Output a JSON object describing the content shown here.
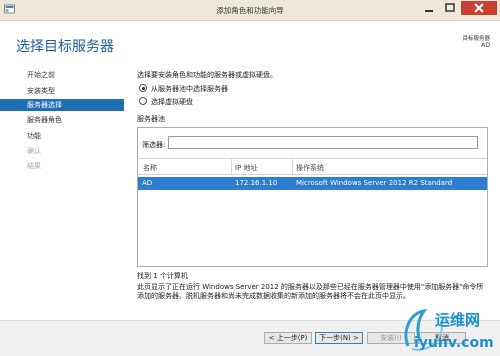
{
  "window": {
    "title": "添加角色和功能向导",
    "colors": {
      "titlebar": "#ede8d9",
      "close_button": "#c84031",
      "accent": "#1f6fb5"
    }
  },
  "header": {
    "page_title": "选择目标服务器",
    "destination_label": "目标服务器",
    "destination_value": "AD"
  },
  "nav": {
    "items": [
      {
        "label": "开始之前",
        "state": "normal"
      },
      {
        "label": "安装类型",
        "state": "normal"
      },
      {
        "label": "服务器选择",
        "state": "active"
      },
      {
        "label": "服务器角色",
        "state": "normal"
      },
      {
        "label": "功能",
        "state": "normal"
      },
      {
        "label": "确认",
        "state": "disabled"
      },
      {
        "label": "结果",
        "state": "disabled"
      }
    ]
  },
  "main": {
    "instruction": "选择要安装角色和功能的服务器或虚拟硬盘。",
    "options": [
      {
        "label": "从服务器池中选择服务器",
        "checked": true
      },
      {
        "label": "选择虚拟硬盘",
        "checked": false
      }
    ],
    "pool_label": "服务器池",
    "filter_label": "筛选器:",
    "filter_value": "",
    "columns": [
      "名称",
      "IP 地址",
      "操作系统"
    ],
    "rows": [
      {
        "name": "AD",
        "ip": "172.16.1.10",
        "os": "Microsoft Windows Server 2012 R2 Standard"
      }
    ],
    "found_count": "找到 1 个计算机",
    "description": "此页显示了正在运行 Windows Server 2012 的服务器以及那些已经在服务器管理器中使用\"添加服务器\"命令所添加的服务器。脱机服务器和尚未完成数据收集的新添加的服务器将不会在此页中显示。"
  },
  "footer": {
    "prev": "< 上一步(P)",
    "next": "下一步(N) >",
    "install": "安装(I)",
    "cancel": "取消"
  },
  "watermark": {
    "text_top": "运维网",
    "text_bottom": "iyunv.com"
  }
}
